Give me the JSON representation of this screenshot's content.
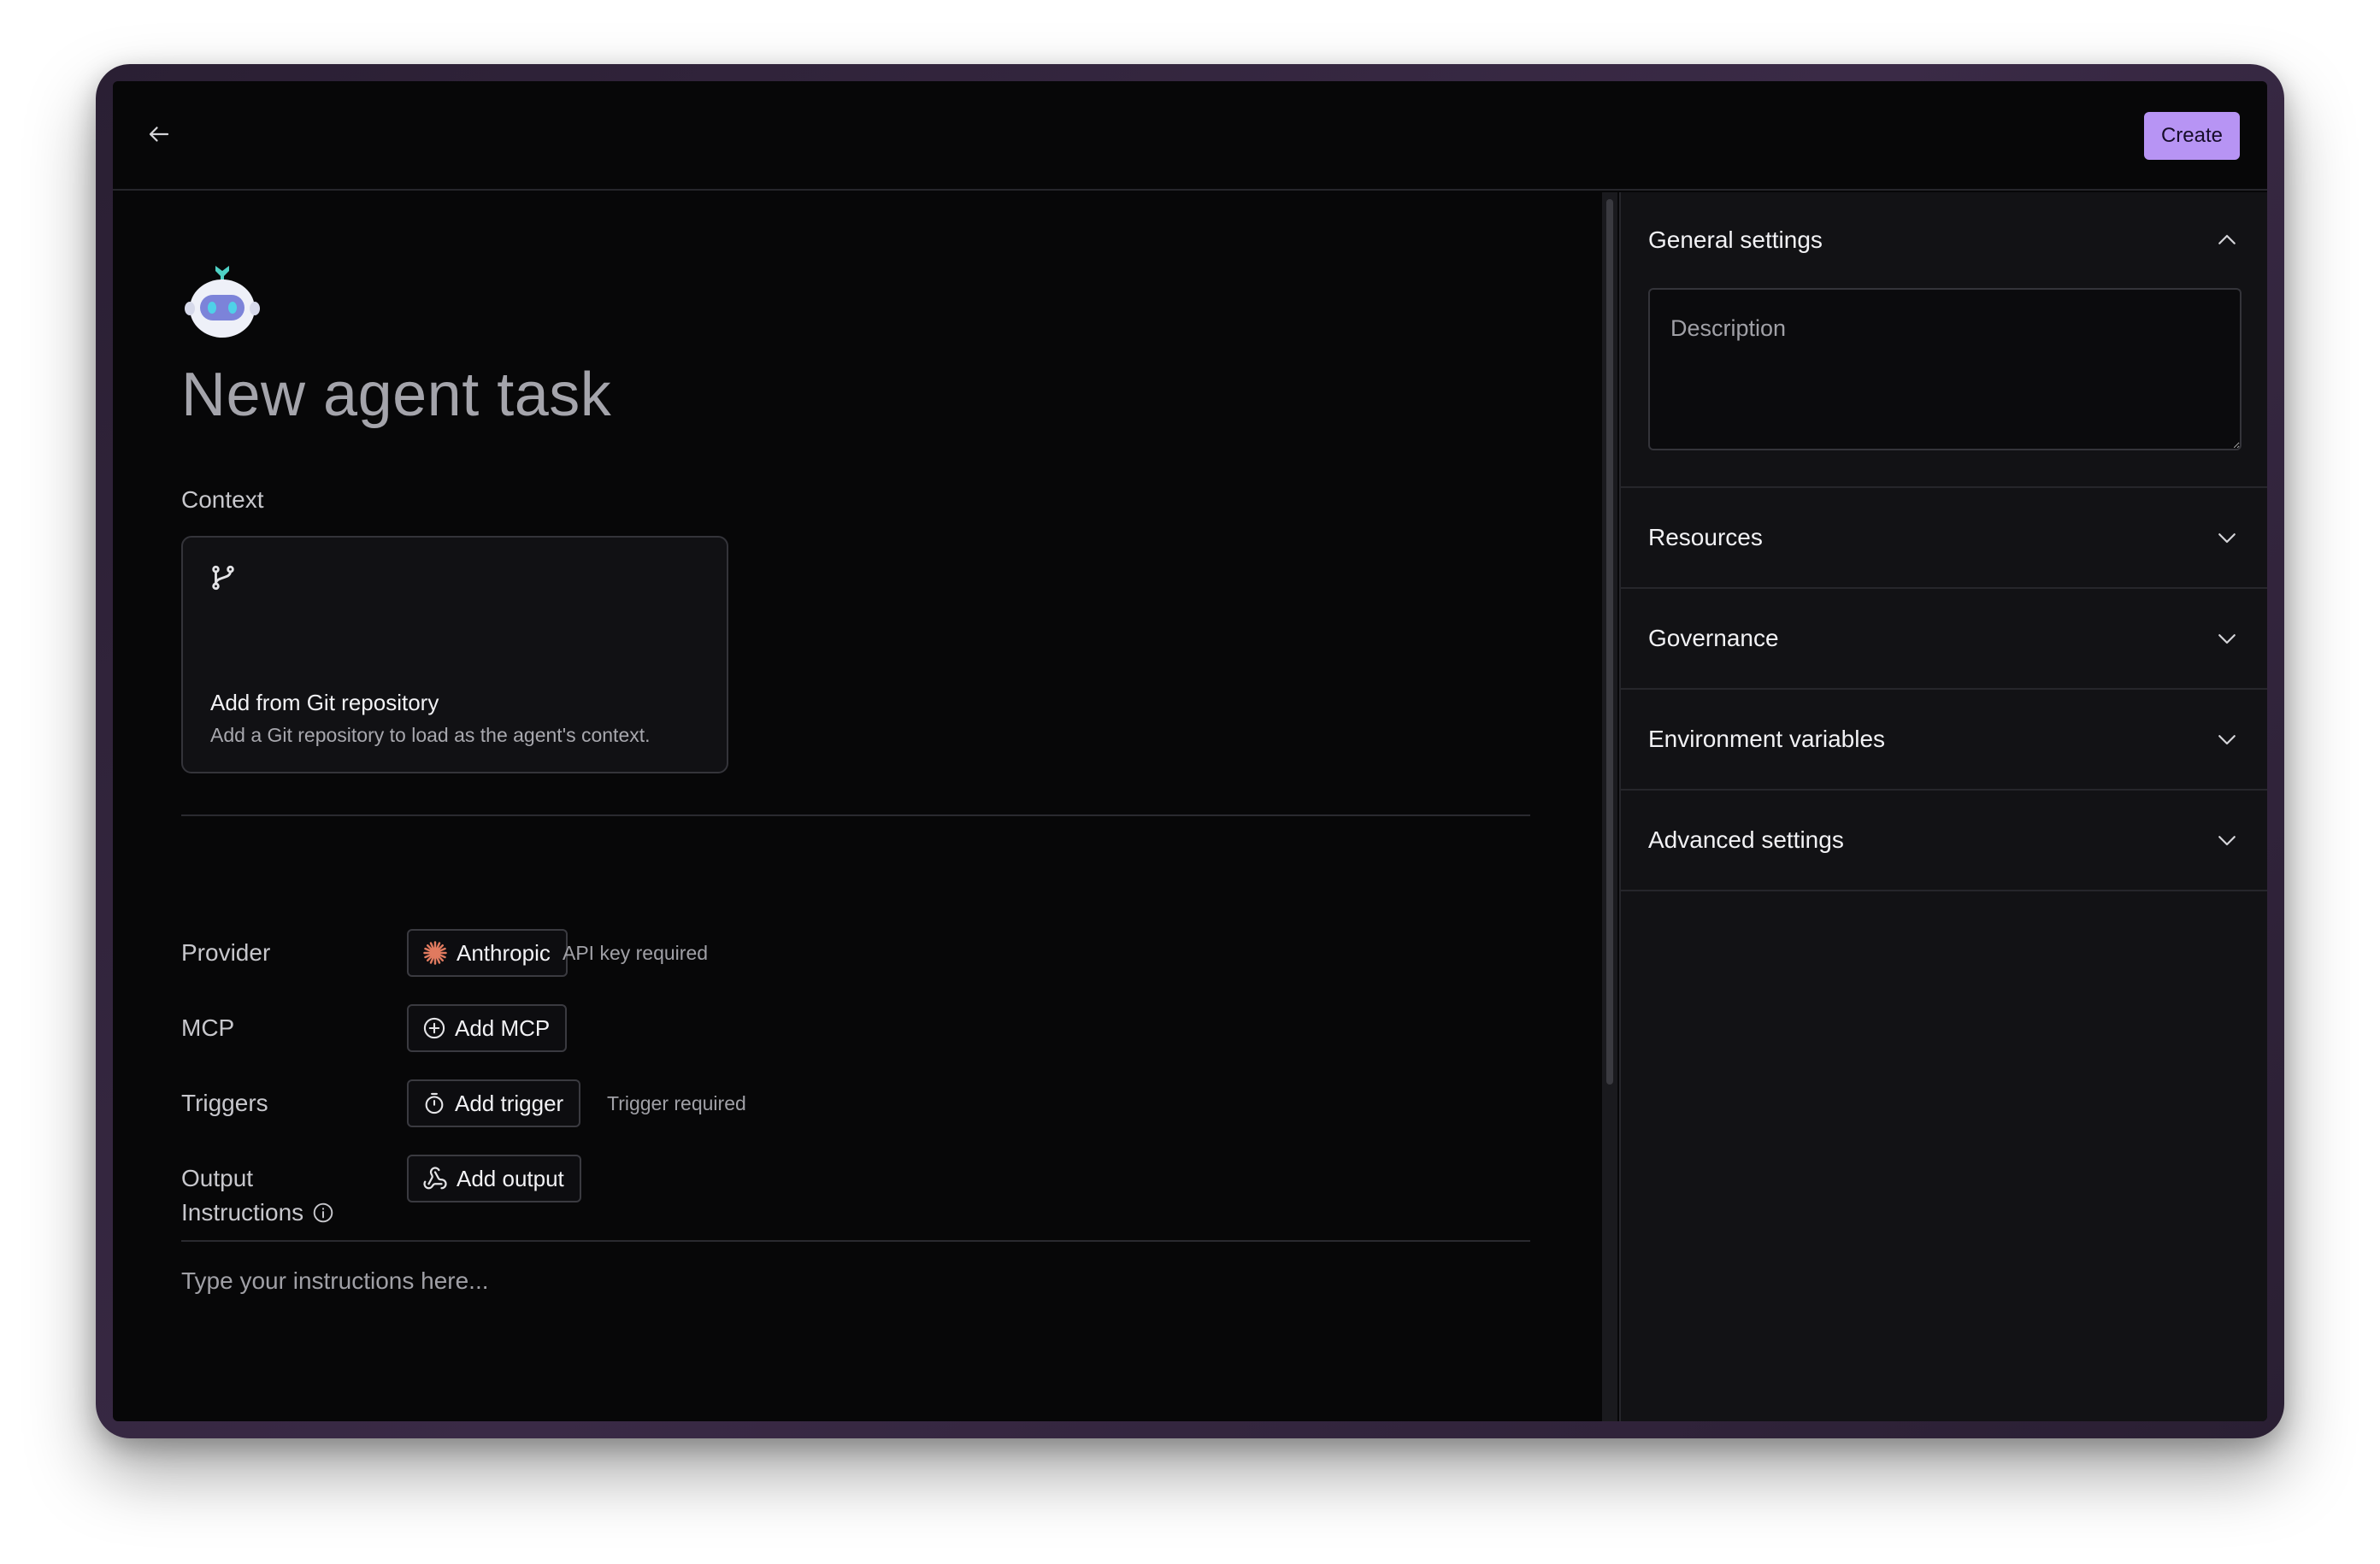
{
  "header": {
    "create_label": "Create"
  },
  "page": {
    "title": "New agent task"
  },
  "context": {
    "label": "Context",
    "git_card": {
      "title": "Add from Git repository",
      "description": "Add a Git repository to load as the agent's context."
    }
  },
  "config": {
    "provider": {
      "label": "Provider",
      "button": "Anthropic",
      "hint": "API key required"
    },
    "mcp": {
      "label": "MCP",
      "button": "Add MCP"
    },
    "triggers": {
      "label": "Triggers",
      "button": "Add trigger",
      "hint": "Trigger required"
    },
    "output": {
      "label": "Output",
      "button": "Add output"
    }
  },
  "instructions": {
    "label": "Instructions",
    "placeholder": "Type your instructions here..."
  },
  "sidebar": {
    "general": {
      "title": "General settings",
      "description_placeholder": "Description"
    },
    "resources": {
      "title": "Resources"
    },
    "governance": {
      "title": "Governance"
    },
    "env_vars": {
      "title": "Environment variables"
    },
    "advanced": {
      "title": "Advanced settings"
    }
  },
  "colors": {
    "accent": "#b794f4",
    "background": "#070708",
    "panel": "#121215",
    "anthropic": "#e07a5f"
  }
}
